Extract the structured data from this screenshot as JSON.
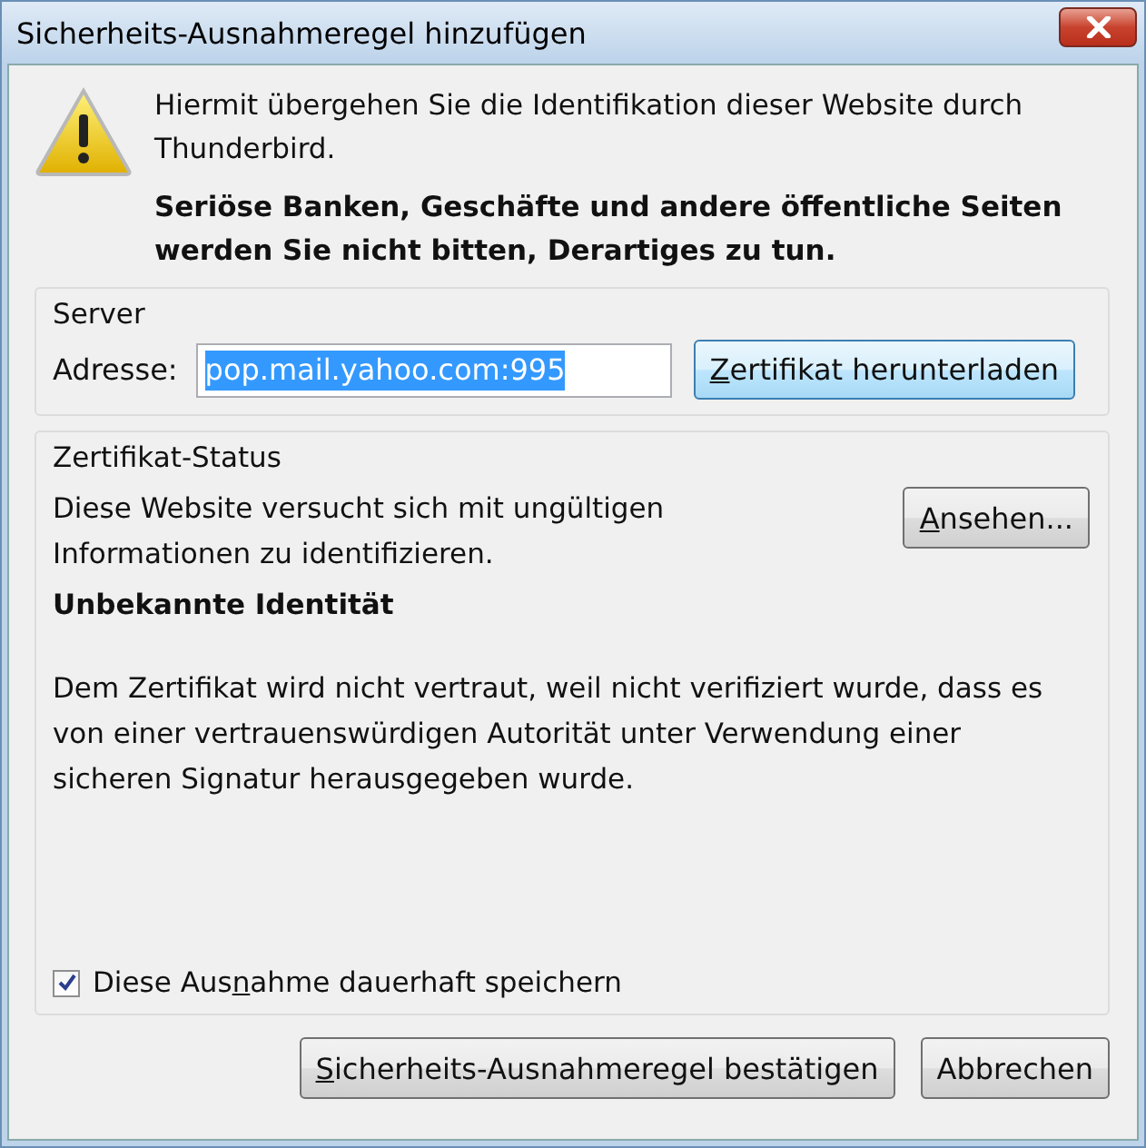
{
  "window": {
    "title": "Sicherheits-Ausnahmeregel hinzufügen"
  },
  "intro": {
    "text": "Hiermit übergehen Sie die Identifikation dieser Website durch Thunderbird.",
    "warning": "Seriöse Banken, Geschäfte und andere öffentliche Seiten werden Sie nicht bitten, Derartiges zu tun."
  },
  "server": {
    "legend": "Server",
    "address_label": "Adresse:",
    "address_value": "pop.mail.yahoo.com:995",
    "download_button": {
      "key": "Z",
      "post": "ertifikat herunterladen"
    }
  },
  "status": {
    "legend": "Zertifikat-Status",
    "text": "Diese Website versucht sich mit ungültigen Informationen zu identifizieren.",
    "view_button": {
      "key": "A",
      "post": "nsehen..."
    },
    "heading": "Unbekannte Identität",
    "details": "Dem Zertifikat wird nicht vertraut, weil nicht verifiziert wurde, dass es von einer vertrauenswürdigen Autorität unter Verwendung einer sicheren Signatur herausgegeben wurde.",
    "permanent": {
      "label": {
        "pre": "Diese Aus",
        "key": "n",
        "post": "ahme dauerhaft speichern"
      },
      "checked": true
    }
  },
  "buttons": [
    {
      "label": {
        "key": "S",
        "post": "icherheits-Ausnahmeregel bestätigen"
      }
    },
    {
      "label": {
        "pre": "Abbrechen"
      }
    }
  ]
}
